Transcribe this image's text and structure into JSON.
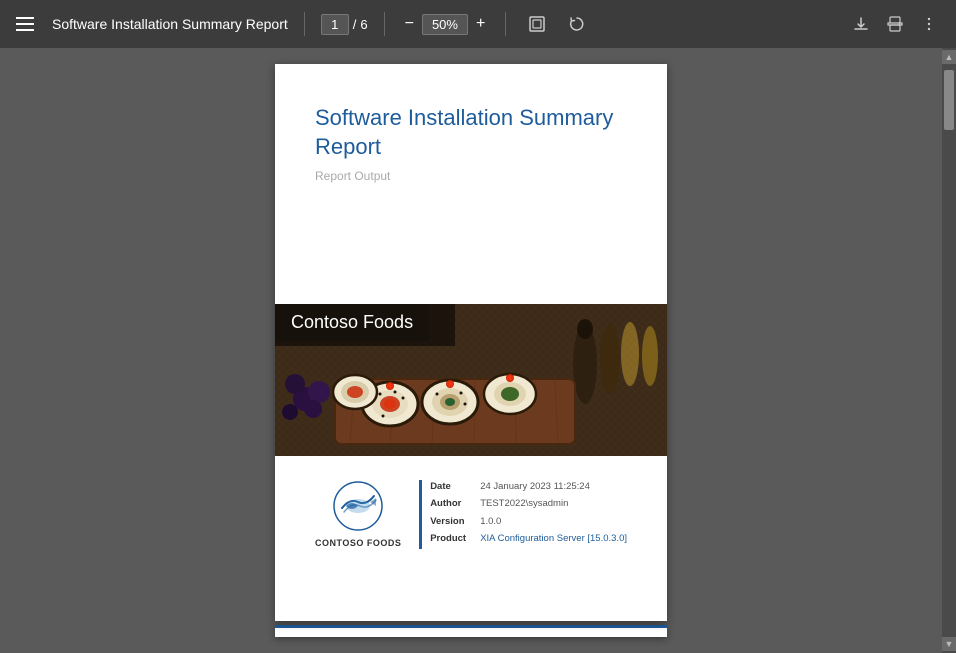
{
  "toolbar": {
    "menu_icon_label": "menu",
    "title": "Software Installation Summary Report",
    "page_current": "1",
    "page_separator": "/",
    "page_total": "6",
    "zoom_minus": "−",
    "zoom_value": "50%",
    "zoom_plus": "+",
    "fit_icon": "⊡",
    "rotate_icon": "↻",
    "download_icon": "⬇",
    "print_icon": "🖨",
    "more_icon": "⋮"
  },
  "pdf": {
    "cover": {
      "title": "Software Installation Summary Report",
      "subtitle": "Report Output",
      "banner_label": "Contoso Foods",
      "logo_company": "CONTOSO FOODS",
      "meta": {
        "date_key": "Date",
        "date_val": "24 January 2023 11:25:24",
        "author_key": "Author",
        "author_val": "TEST2022\\sysadmin",
        "version_key": "Version",
        "version_val": "1.0.0",
        "product_key": "Product",
        "product_val": "XIA Configuration Server [15.0.3.0]"
      }
    }
  },
  "scrollbar": {
    "up_arrow": "▲",
    "down_arrow": "▼"
  }
}
